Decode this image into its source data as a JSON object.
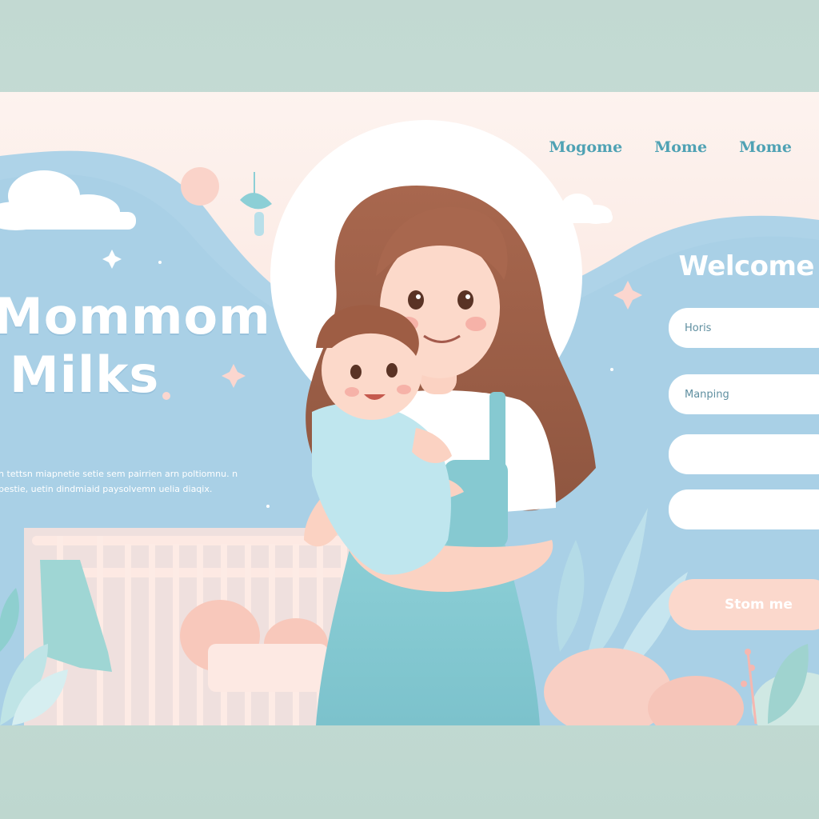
{
  "nav": {
    "items": [
      "Mogome",
      "Mome",
      "Mome"
    ]
  },
  "hero": {
    "brand_line1": "Mommom",
    "brand_line2": "Milks",
    "tagline": "n tettsn miapnetie setie sem pairrien arn poltiomnu. n pestie, uetin dindmiaid paysolvemn uelia diaqix."
  },
  "form": {
    "title": "Welcome",
    "fields": [
      {
        "placeholder": "Horis",
        "value": ""
      },
      {
        "placeholder": "Manping",
        "value": ""
      },
      {
        "placeholder": "",
        "value": ""
      },
      {
        "placeholder": "",
        "value": ""
      }
    ],
    "submit_label": "Stom me"
  },
  "colors": {
    "nav_text": "#4fa2b4",
    "sky_blue": "#a9d0e6",
    "blush_pink": "#fbd8cc",
    "dress_teal": "#86c9d1"
  },
  "illustration": {
    "subject": "mother-holding-baby-icon",
    "crib": "crib-icon",
    "plants": "leaf-icon"
  }
}
